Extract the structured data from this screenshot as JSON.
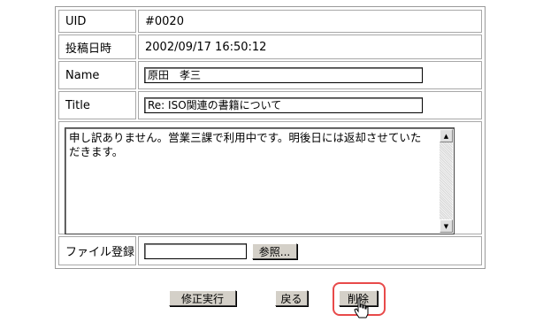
{
  "form": {
    "uid_label": "UID",
    "uid_value": "#0020",
    "date_label": "投稿日時",
    "date_value": "2002/09/17 16:50:12",
    "name_label": "Name",
    "name_value": "原田　孝三",
    "title_label": "Title",
    "title_value": "Re: ISO関連の書籍について",
    "body_text": "申し訳ありません。営業三課で利用中です。明後日には返却させていた\nだきます。",
    "file_label": "ファイル登録",
    "file_value": "",
    "browse_label": "参照..."
  },
  "actions": {
    "submit_label": "修正実行",
    "back_label": "戻る",
    "delete_label": "削除"
  },
  "icons": {
    "scroll_up": "scroll-up-arrow-icon",
    "scroll_down": "scroll-down-arrow-icon",
    "cursor": "hand-pointer-icon"
  },
  "colors": {
    "highlight": "#e84a4a",
    "button_face": "#d4d0c8"
  }
}
